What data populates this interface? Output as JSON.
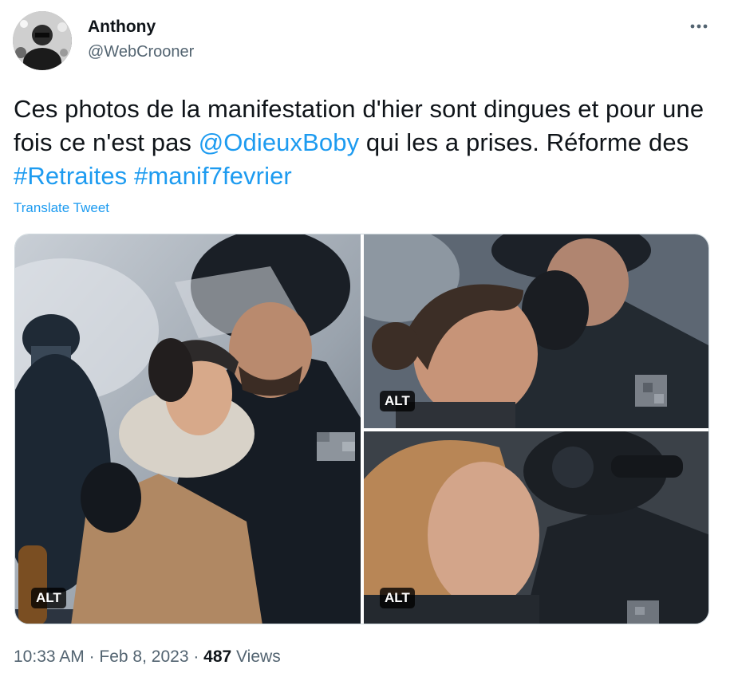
{
  "author": {
    "name": "Anthony",
    "handle": "@WebCrooner",
    "avatar_icon": "avatar-image"
  },
  "more_icon": "more-horizontal-icon",
  "tweet": {
    "text_1": "Ces photos de la manifestation d'hier sont dingues et pour une fois ce n'est pas ",
    "mention": "@OdieuxBoby",
    "text_2": " qui les a prises. Réforme des ",
    "hashtag_1": "#Retraites",
    "space": " ",
    "hashtag_2": "#manif7fevrier",
    "translate_label": "Translate Tweet"
  },
  "media": {
    "photos": [
      {
        "alt_label": "ALT"
      },
      {
        "alt_label": "ALT"
      },
      {
        "alt_label": "ALT"
      }
    ]
  },
  "meta": {
    "time": "10:33 AM",
    "sep1": " · ",
    "date": "Feb 8, 2023",
    "sep2": " · ",
    "views_count": "487",
    "views_label": " Views"
  },
  "colors": {
    "link": "#1d9bf0",
    "secondary_text": "#536471",
    "primary_text": "#0f1419"
  }
}
